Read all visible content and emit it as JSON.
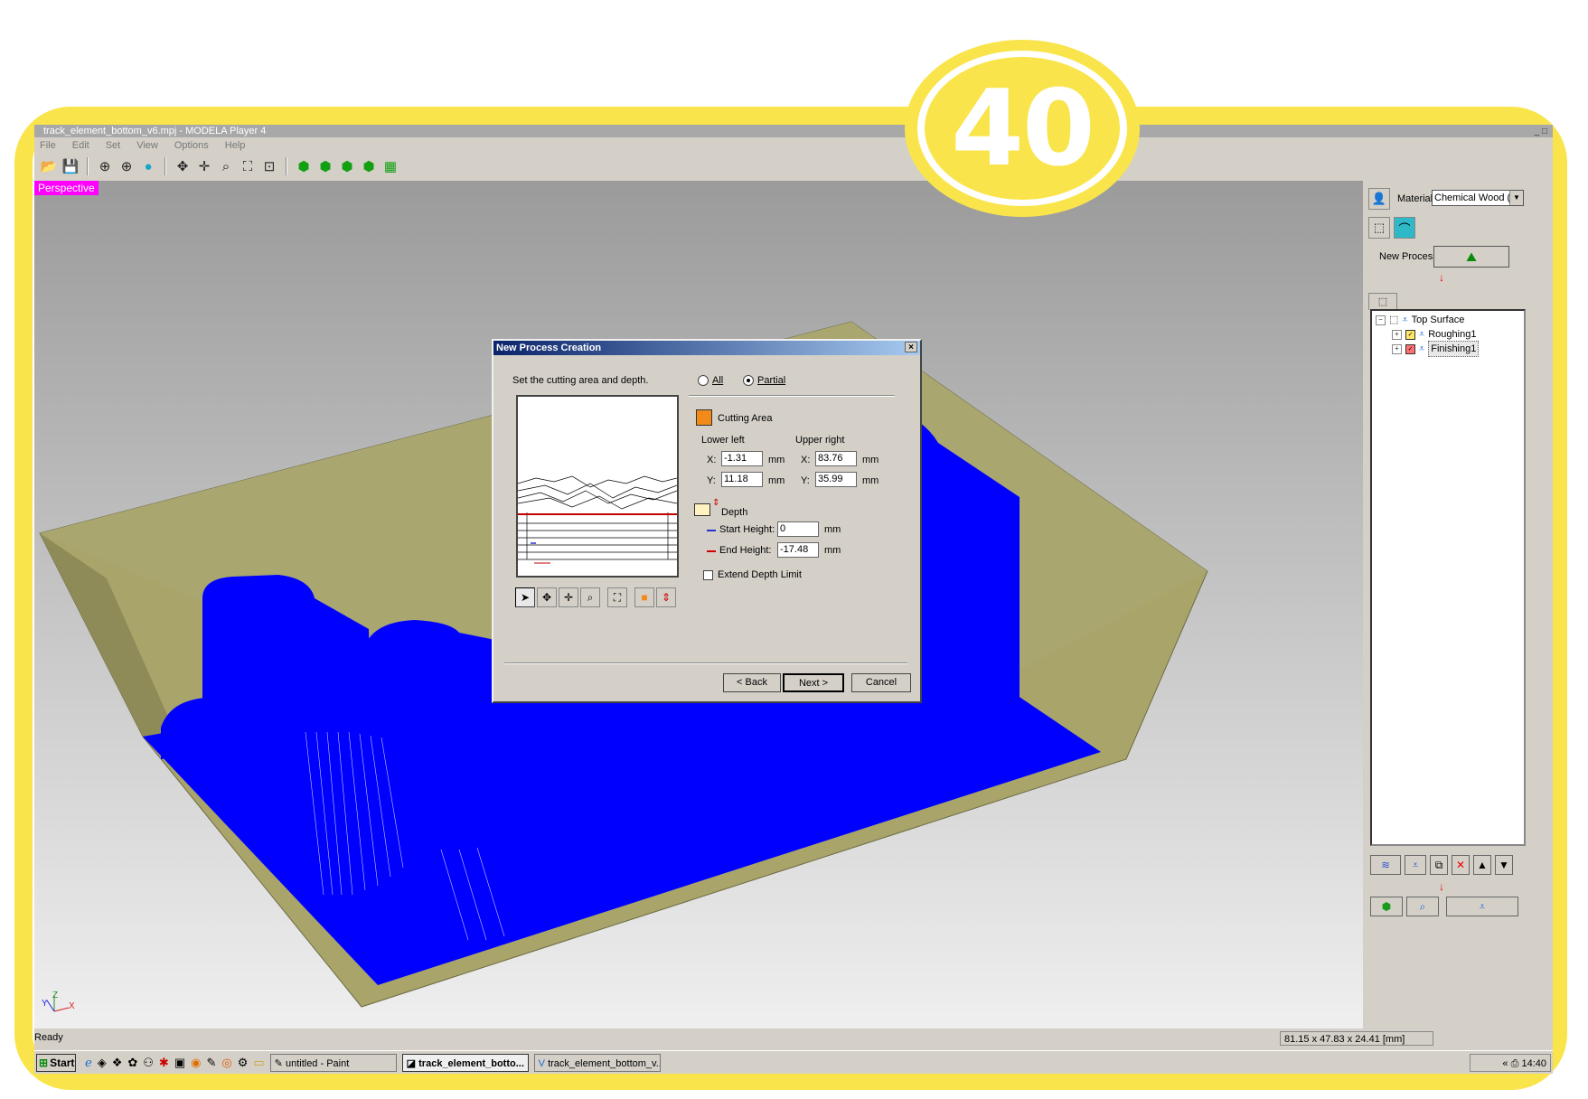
{
  "badge": {
    "number": "40"
  },
  "window": {
    "title": "track_element_bottom_v6.mpj - MODELA Player 4",
    "controls": "_ □",
    "menu": [
      "File",
      "Edit",
      "Set",
      "View",
      "Options",
      "Help"
    ]
  },
  "viewport": {
    "mode": "Perspective",
    "axes": {
      "x": "X",
      "y": "Y",
      "z": "Z"
    }
  },
  "status": {
    "text": "Ready",
    "dims": "81.15 x 47.83 x 24.41 [mm]"
  },
  "panel": {
    "material_label": "Material",
    "material_value": "Chemical Wood (Sc",
    "new_process_label": "New Process",
    "tree": {
      "root": "Top Surface",
      "items": [
        "Roughing1",
        "Finishing1"
      ]
    }
  },
  "dialog": {
    "title": "New Process Creation",
    "close": "×",
    "instruction": "Set the cutting area and depth.",
    "radio_all": "All",
    "radio_partial": "Partial",
    "cutting_area": "Cutting Area",
    "lower_left": "Lower left",
    "upper_right": "Upper right",
    "x_label": "X:",
    "y_label": "Y:",
    "unit": "mm",
    "ll_x": "-1.31",
    "ll_y": "11.18",
    "ur_x": "83.76",
    "ur_y": "35.99",
    "depth": "Depth",
    "start_height_label": "Start Height:",
    "start_height": "0",
    "end_height_label": "End Height:",
    "end_height": "-17.48",
    "extend_depth": "Extend Depth Limit",
    "back": "< Back",
    "next": "Next >",
    "cancel": "Cancel"
  },
  "taskbar": {
    "start": "Start",
    "tasks": [
      "untitled - Paint",
      "track_element_botto...",
      "track_element_bottom_v..."
    ],
    "tray_chevron": "«",
    "clock": "14:40"
  },
  "colors": {
    "accent": "#f9e54b",
    "model": "#0000ff",
    "stock": "#a8a46a",
    "perspective": "#ff00ff"
  }
}
